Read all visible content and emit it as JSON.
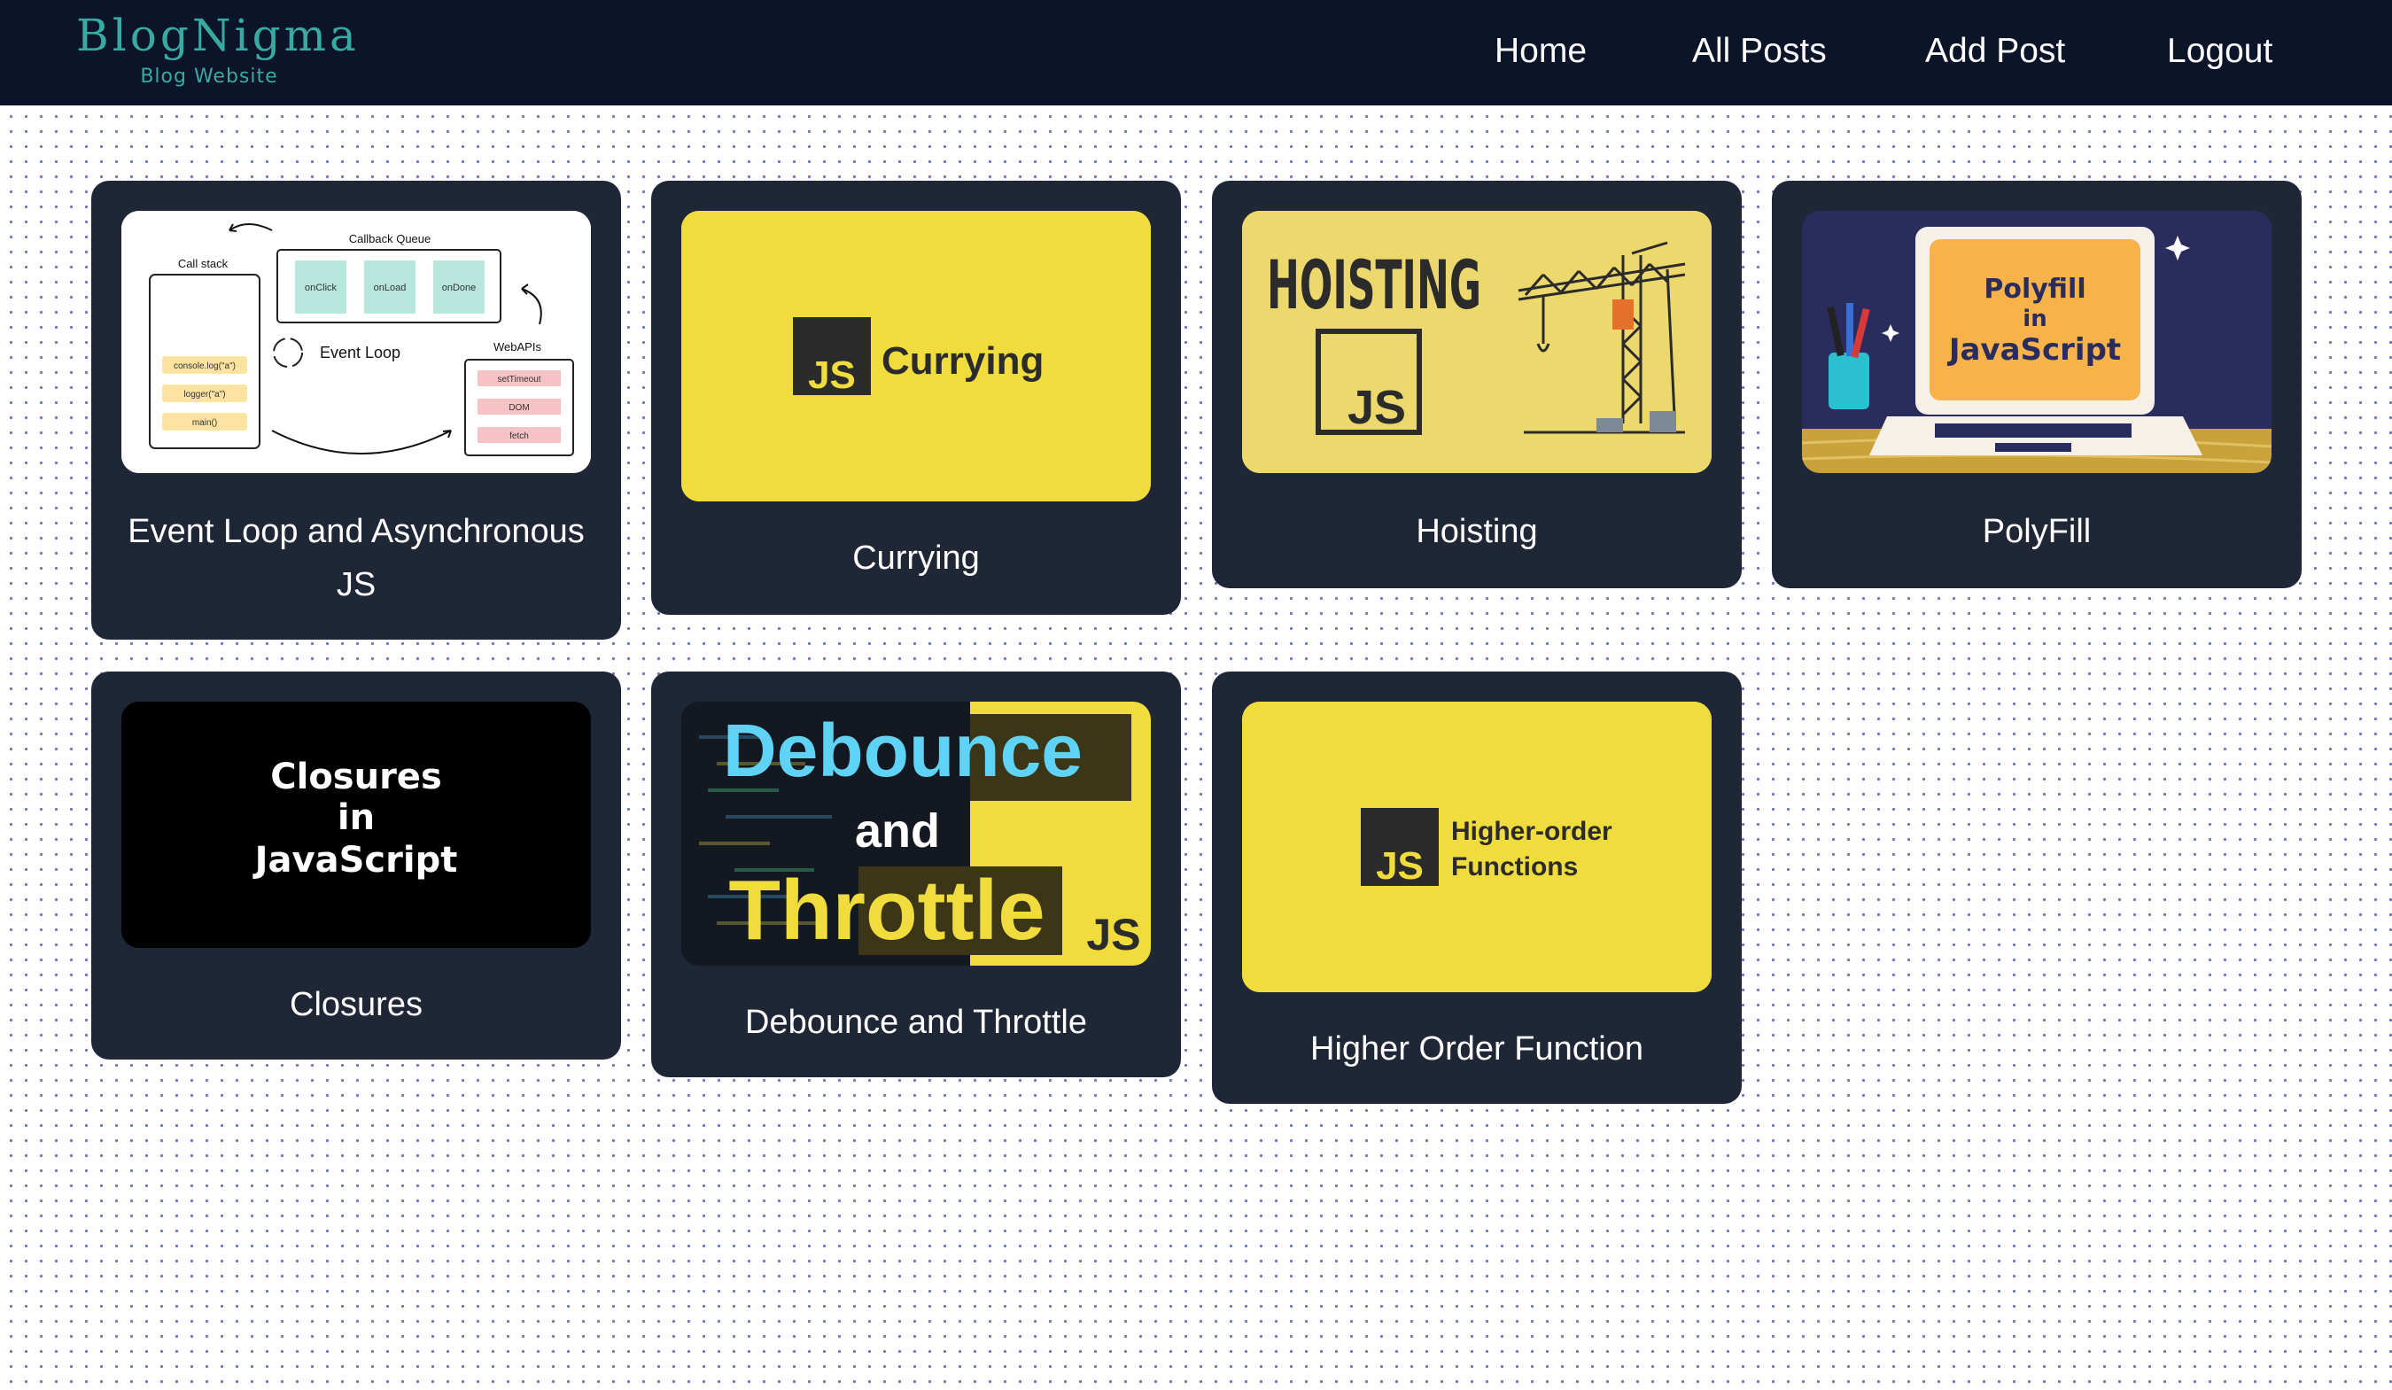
{
  "brand": {
    "title": "BlogNigma",
    "subtitle": "Blog Website"
  },
  "nav": {
    "home": "Home",
    "all_posts": "All Posts",
    "add_post": "Add Post",
    "logout": "Logout"
  },
  "posts": [
    {
      "title": "Event Loop and Asynchronous JS",
      "thumb": {
        "call_stack": "Call stack",
        "callback_queue": "Callback Queue",
        "queue_items": [
          "onClick",
          "onLoad",
          "onDone"
        ],
        "event_loop": "Event Loop",
        "webapis": "WebAPIs",
        "webapi_items": [
          "setTimeout",
          "DOM",
          "fetch"
        ],
        "stack_items": [
          "console.log(\"a\")",
          "logger(\"a\")",
          "main()"
        ]
      }
    },
    {
      "title": "Currying",
      "thumb": {
        "badge": "JS",
        "text": "Currying"
      }
    },
    {
      "title": "Hoisting",
      "thumb": {
        "heading": "HOISTING",
        "badge": "JS"
      }
    },
    {
      "title": "PolyFill",
      "thumb": {
        "line1": "Polyfill",
        "line2": "in",
        "line3": "JavaScript"
      }
    },
    {
      "title": "Closures",
      "thumb": {
        "line1": "Closures",
        "line2": "in",
        "line3": "JavaScript"
      }
    },
    {
      "title": "Debounce and Throttle",
      "thumb": {
        "word1": "Debounce",
        "word2": "and",
        "word3": "Throttle",
        "badge": "JS"
      }
    },
    {
      "title": "Higher Order Function",
      "thumb": {
        "badge": "JS",
        "line1": "Higher-order",
        "line2": "Functions"
      }
    }
  ],
  "colors": {
    "navbar": "#0b1428",
    "brand": "#39aaa2",
    "card": "#1f2636",
    "js_yellow": "#f0dc3c",
    "polyfill_bg": "#2b2c5e"
  }
}
